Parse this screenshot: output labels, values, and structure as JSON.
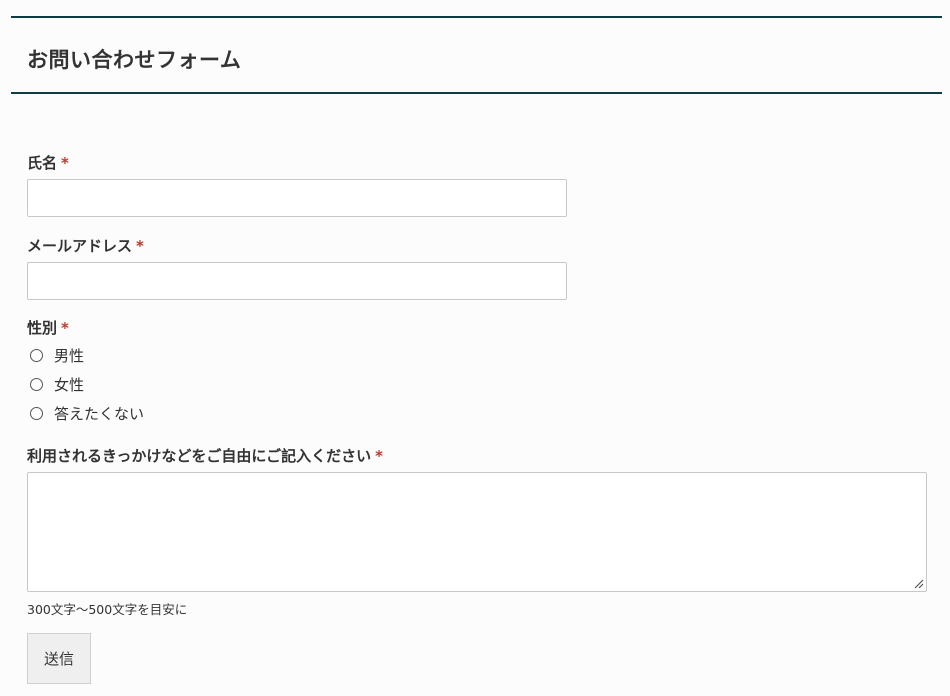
{
  "form": {
    "title": "お問い合わせフォーム",
    "required_mark": "*",
    "name_field": {
      "label": "氏名",
      "value": ""
    },
    "email_field": {
      "label": "メールアドレス",
      "value": ""
    },
    "gender_field": {
      "label": "性別",
      "options": [
        "男性",
        "女性",
        "答えたくない"
      ]
    },
    "reason_field": {
      "label": "利用されるきっかけなどをご自由にご記入ください",
      "value": "",
      "hint": "300文字〜500文字を目安に"
    },
    "submit_label": "送信"
  },
  "colors": {
    "header_border": "#0f3b44",
    "required": "#c0392b",
    "background": "#fcfcfc"
  }
}
